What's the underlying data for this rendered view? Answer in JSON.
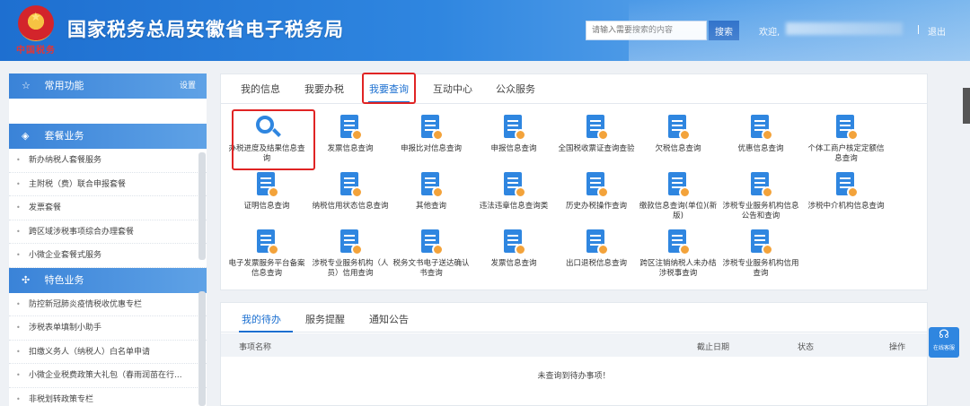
{
  "header": {
    "emblem_text": "中国税务",
    "title": "国家税务总局安徽省电子税务局",
    "search_placeholder": "请输入需要搜索的内容",
    "search_label": "搜索",
    "welcome": "欢迎,",
    "logout": "退出"
  },
  "sidebar": {
    "common": {
      "label": "常用功能",
      "settings": "设置"
    },
    "package": {
      "label": "套餐业务",
      "items": [
        "新办纳税人套餐服务",
        "主附税（费）联合申报套餐",
        "发票套餐",
        "跨区域涉税事项综合办理套餐",
        "小微企业套餐式服务"
      ]
    },
    "special": {
      "label": "特色业务",
      "items": [
        "防控新冠肺炎疫情税收优惠专栏",
        "涉税表单填制小助手",
        "扣缴义务人（纳税人）白名单申请",
        "小微企业税费政策大礼包（春雨润苗在行...",
        "非税划转政策专栏"
      ]
    }
  },
  "tabs": [
    "我的信息",
    "我要办税",
    "我要查询",
    "互动中心",
    "公众服务"
  ],
  "query_items": [
    "办税进度及结果信息查询",
    "发票信息查询",
    "申报比对信息查询",
    "申报信息查询",
    "全国税收票证查询查验",
    "欠税信息查询",
    "优惠信息查询",
    "个体工商户核定定额信息查询",
    "证明信息查询",
    "纳税信用状态信息查询",
    "其他查询",
    "违法违章信息查询类",
    "历史办税操作查询",
    "缴款信息查询(单位)(新版)",
    "涉税专业服务机构信息公告和查询",
    "涉税中介机构信息查询",
    "电子发票服务平台备案信息查询",
    "涉税专业服务机构（人员）信用查询",
    "税务文书电子送达确认书查询",
    "发票信息查询",
    "出口退税信息查询",
    "跨区注销纳税人未办结涉税事查询",
    "涉税专业服务机构信用查询"
  ],
  "todo": {
    "tabs": [
      "我的待办",
      "服务提醒",
      "通知公告"
    ],
    "columns": [
      "事项名称",
      "截止日期",
      "状态",
      "操作"
    ],
    "empty": "未查询到待办事项！"
  },
  "help": {
    "label": "在线客服"
  },
  "colors": {
    "primary": "#2f86e0",
    "highlight": "#e02424",
    "badge": "#f3a33b"
  }
}
